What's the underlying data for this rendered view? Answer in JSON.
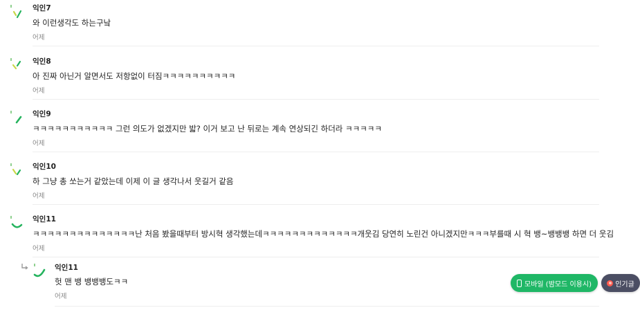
{
  "comments": [
    {
      "author": "익인7",
      "text": "와 이런생각도 하는구낰",
      "time": "어제",
      "avatar_icon": "dash-green-avatar-icon"
    },
    {
      "author": "익인8",
      "text": "아 진짜 아닌거 알면서도 저항없이 터짐ㅋㅋㅋㅋㅋㅋㅋㅋㅋㅋ",
      "time": "어제",
      "avatar_icon": "dash-green-avatar-icon"
    },
    {
      "author": "익인9",
      "text": "ㅋㅋㅋㅋㅋㅋㅋㅋㅋㅋㅋ 그런 의도가 없겠지만 밟? 이거 보고 난 뒤로는 계속 연상되긴 하더라 ㅋㅋㅋㅋㅋ",
      "time": "어제",
      "avatar_icon": "dash-green-avatar-icon"
    },
    {
      "author": "익인10",
      "text": "하 그냥 총 쏘는거 같았는데 이제 이 글 생각나서 웃길거 같음",
      "time": "어제",
      "avatar_icon": "dash-green-avatar-icon"
    },
    {
      "author": "익인11",
      "text": "ㅋㅋㅋㅋㅋㅋㅋㅋㅋㅋㅋㅋㅋㅋ난 처음 봤을때부터 방시혁 생각했는데ㅋㅋㅋㅋㅋㅋㅋㅋㅋㅋㅋㅋㅋ개웃김 당연히 노린건 아니겠지만ㅋㅋㅋ부를때 시 혁 뱅~뱅뱅뱅 하면 더 웃김",
      "time": "어제",
      "avatar_icon": "curve-green-avatar-icon"
    }
  ],
  "reply": {
    "author": "익인11",
    "text": "헛 맨 뱅 뱅뱅뱅도ㅋㅋ",
    "time": "어제",
    "avatar_icon": "curve-green-avatar-icon",
    "reply_icon": "reply-arrow-icon"
  },
  "buttons": {
    "mobile_label": "모바일 (밤모드 이용시)",
    "mobile_icon": "phone-icon",
    "popular_label": "인기글",
    "popular_icon": "fire-icon"
  },
  "colors": {
    "accent_green": "#1fb766",
    "popular_bg": "#4b4e63",
    "avatar_yellow_green": "#c8d84a",
    "avatar_green": "#25b35e"
  }
}
